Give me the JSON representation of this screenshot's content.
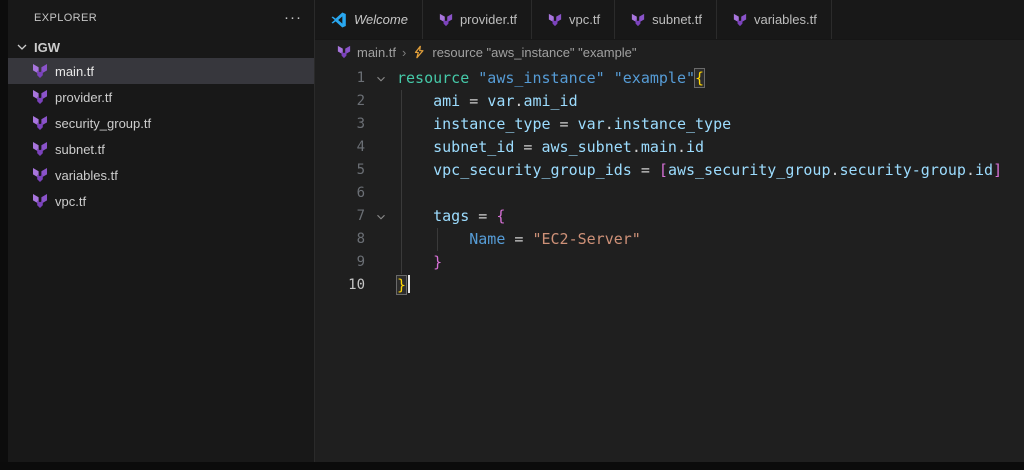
{
  "sidebar": {
    "title": "EXPLORER",
    "more_icon": "ellipsis",
    "section": "IGW",
    "files": [
      {
        "name": "main.tf",
        "selected": true
      },
      {
        "name": "provider.tf",
        "selected": false
      },
      {
        "name": "security_group.tf",
        "selected": false
      },
      {
        "name": "subnet.tf",
        "selected": false
      },
      {
        "name": "variables.tf",
        "selected": false
      },
      {
        "name": "vpc.tf",
        "selected": false
      }
    ]
  },
  "tabs": [
    {
      "label": "Welcome",
      "icon": "vscode",
      "italic": true
    },
    {
      "label": "provider.tf",
      "icon": "terraform",
      "italic": false
    },
    {
      "label": "vpc.tf",
      "icon": "terraform",
      "italic": false
    },
    {
      "label": "subnet.tf",
      "icon": "terraform",
      "italic": false
    },
    {
      "label": "variables.tf",
      "icon": "terraform",
      "italic": false
    }
  ],
  "breadcrumb": {
    "file": "main.tf",
    "separator": "›",
    "symbol": "resource \"aws_instance\" \"example\""
  },
  "colors": {
    "accent_purple": "#7b42bc",
    "accent_blue": "#29a8f1",
    "symbol_orange": "#e2a03b",
    "editor_bg": "#1f1f1f",
    "sidebar_bg": "#181818"
  },
  "code": {
    "lines": [
      {
        "fold": true,
        "cursor": false,
        "guides": [],
        "tokens": [
          {
            "t": "resource",
            "c": "kw"
          },
          {
            "t": " ",
            "c": "op"
          },
          {
            "t": "\"aws_instance\"",
            "c": "str"
          },
          {
            "t": " ",
            "c": "op"
          },
          {
            "t": "\"example\"",
            "c": "str"
          },
          {
            "t": "{",
            "c": "b1",
            "match": true
          }
        ]
      },
      {
        "fold": false,
        "cursor": false,
        "guides": [
          4
        ],
        "tokens": [
          {
            "t": "    ",
            "c": "op"
          },
          {
            "t": "ami",
            "c": "prop"
          },
          {
            "t": " = ",
            "c": "op"
          },
          {
            "t": "var",
            "c": "prop"
          },
          {
            "t": ".",
            "c": "op"
          },
          {
            "t": "ami_id",
            "c": "prop"
          }
        ]
      },
      {
        "fold": false,
        "cursor": false,
        "guides": [
          4
        ],
        "tokens": [
          {
            "t": "    ",
            "c": "op"
          },
          {
            "t": "instance_type",
            "c": "prop"
          },
          {
            "t": " = ",
            "c": "op"
          },
          {
            "t": "var",
            "c": "prop"
          },
          {
            "t": ".",
            "c": "op"
          },
          {
            "t": "instance_type",
            "c": "prop"
          }
        ]
      },
      {
        "fold": false,
        "cursor": false,
        "guides": [
          4
        ],
        "tokens": [
          {
            "t": "    ",
            "c": "op"
          },
          {
            "t": "subnet_id",
            "c": "prop"
          },
          {
            "t": " = ",
            "c": "op"
          },
          {
            "t": "aws_subnet",
            "c": "prop"
          },
          {
            "t": ".",
            "c": "op"
          },
          {
            "t": "main",
            "c": "prop"
          },
          {
            "t": ".",
            "c": "op"
          },
          {
            "t": "id",
            "c": "prop"
          }
        ]
      },
      {
        "fold": false,
        "cursor": false,
        "guides": [
          4
        ],
        "tokens": [
          {
            "t": "    ",
            "c": "op"
          },
          {
            "t": "vpc_security_group_ids",
            "c": "prop"
          },
          {
            "t": " = ",
            "c": "op"
          },
          {
            "t": "[",
            "c": "b2"
          },
          {
            "t": "aws_security_group",
            "c": "prop"
          },
          {
            "t": ".",
            "c": "op"
          },
          {
            "t": "security-group",
            "c": "prop"
          },
          {
            "t": ".",
            "c": "op"
          },
          {
            "t": "id",
            "c": "prop"
          },
          {
            "t": "]",
            "c": "b2"
          }
        ]
      },
      {
        "fold": false,
        "cursor": false,
        "guides": [
          4
        ],
        "tokens": []
      },
      {
        "fold": true,
        "cursor": false,
        "guides": [
          4
        ],
        "tokens": [
          {
            "t": "    ",
            "c": "op"
          },
          {
            "t": "tags",
            "c": "prop"
          },
          {
            "t": " = ",
            "c": "op"
          },
          {
            "t": "{",
            "c": "b2"
          }
        ]
      },
      {
        "fold": false,
        "cursor": false,
        "guides": [
          4,
          40
        ],
        "tokens": [
          {
            "t": "        ",
            "c": "op"
          },
          {
            "t": "Name",
            "c": "ref"
          },
          {
            "t": " = ",
            "c": "op"
          },
          {
            "t": "\"EC2-Server\"",
            "c": "str2"
          }
        ]
      },
      {
        "fold": false,
        "cursor": false,
        "guides": [
          4
        ],
        "tokens": [
          {
            "t": "    ",
            "c": "op"
          },
          {
            "t": "}",
            "c": "b2"
          }
        ]
      },
      {
        "fold": false,
        "cursor": true,
        "guides": [],
        "tokens": [
          {
            "t": "}",
            "c": "b1",
            "match": true
          }
        ]
      }
    ]
  }
}
